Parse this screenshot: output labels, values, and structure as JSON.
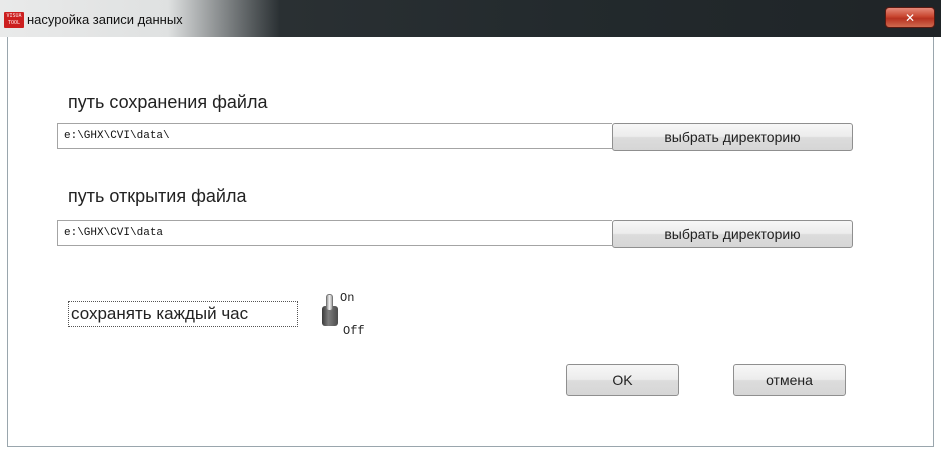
{
  "window": {
    "title": "насуройка записи данных",
    "icon_text": [
      "VISUA",
      "TOOL"
    ],
    "close_symbol": "✕"
  },
  "save_path": {
    "label": "путь сохранения файла",
    "value": "e:\\GHX\\CVI\\data\\",
    "browse_button": "выбрать директорию"
  },
  "open_path": {
    "label": "путь открытия файла",
    "value": "e:\\GHX\\CVI\\data",
    "browse_button": "выбрать директорию"
  },
  "hourly_save": {
    "label": "сохранять каждый час",
    "on_label": "On",
    "off_label": "Off",
    "state": "Off"
  },
  "footer": {
    "ok_label": "OK",
    "cancel_label": "отмена"
  },
  "colors": {
    "close_button": "#c8452f",
    "title_bar": "#1f2427",
    "app_icon": "#cc1f1f"
  }
}
